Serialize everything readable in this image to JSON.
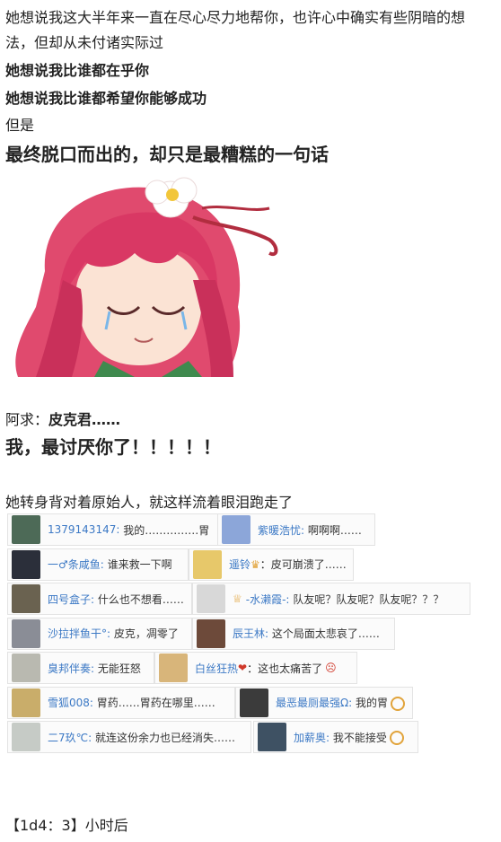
{
  "lines": {
    "p1": "她想说我这大半年来一直在尽心尽力地帮你，也许心中确实有些阴暗的想",
    "p1b": "法，但却从未付诸实际过",
    "p2": "她想说我比谁都在乎你",
    "p3": "她想说我比谁都希望你能够成功",
    "p4": "但是",
    "p5": "最终脱口而出的，却只是最糟糕的一句话",
    "speaker": "阿求：",
    "speaker_name": "皮克君……",
    "shout": "我，最讨厌你了！！！！！",
    "p6": "她转身背对着原始人，就这样流着眼泪跑走了",
    "footer": "【1d4：3】小时后"
  },
  "comments": [
    [
      {
        "user": "1379143147:",
        "text": "我的……………胃",
        "avatar_color": "#4d6a57"
      },
      {
        "user": "紫暖浩忧:",
        "text": "啊啊啊……",
        "avatar_color": "#8ca6d9"
      }
    ],
    [
      {
        "user": "一♂条咸鱼:",
        "text": "谁来救一下啊",
        "avatar_color": "#2b2f3a"
      },
      {
        "user": "遥铃",
        "text": "皮可崩溃了……",
        "avatar_color": "#e7c86a"
      }
    ],
    [
      {
        "user": "四号盒子:",
        "text": "什么也不想看……",
        "avatar_color": "#6a6250"
      },
      {
        "user": "-水濑霞-:",
        "text": "队友呢？队友呢？队友呢？？？",
        "avatar_color": "#d8d8d8"
      }
    ],
    [
      {
        "user": "沙拉拌鱼干°:",
        "text": "皮克，凋零了",
        "avatar_color": "#8a8d96"
      },
      {
        "user": "辰王林:",
        "text": "这个局面太悲哀了……",
        "avatar_color": "#6d4a3a"
      }
    ],
    [
      {
        "user": "臭邦伴奏:",
        "text": "无能狂怒",
        "avatar_color": "#b9b9b0"
      },
      {
        "user": "白丝狂热",
        "text": "这也太痛苦了",
        "avatar_color": "#d8b57a"
      }
    ],
    [
      {
        "user": "雪狐008:",
        "text": "胃药……胃药在哪里……",
        "avatar_color": "#c9ad6a"
      },
      {
        "user": "最恶最厕最强Ω:",
        "text": "我的胃",
        "avatar_color": "#3b3b3b"
      }
    ],
    [
      {
        "user": "二7玖℃:",
        "text": "就连这份余力也已经消失……",
        "avatar_color": "#c6cbc6"
      },
      {
        "user": "加薪奥:",
        "text": "我不能接受",
        "avatar_color": "#3e5163"
      }
    ]
  ]
}
